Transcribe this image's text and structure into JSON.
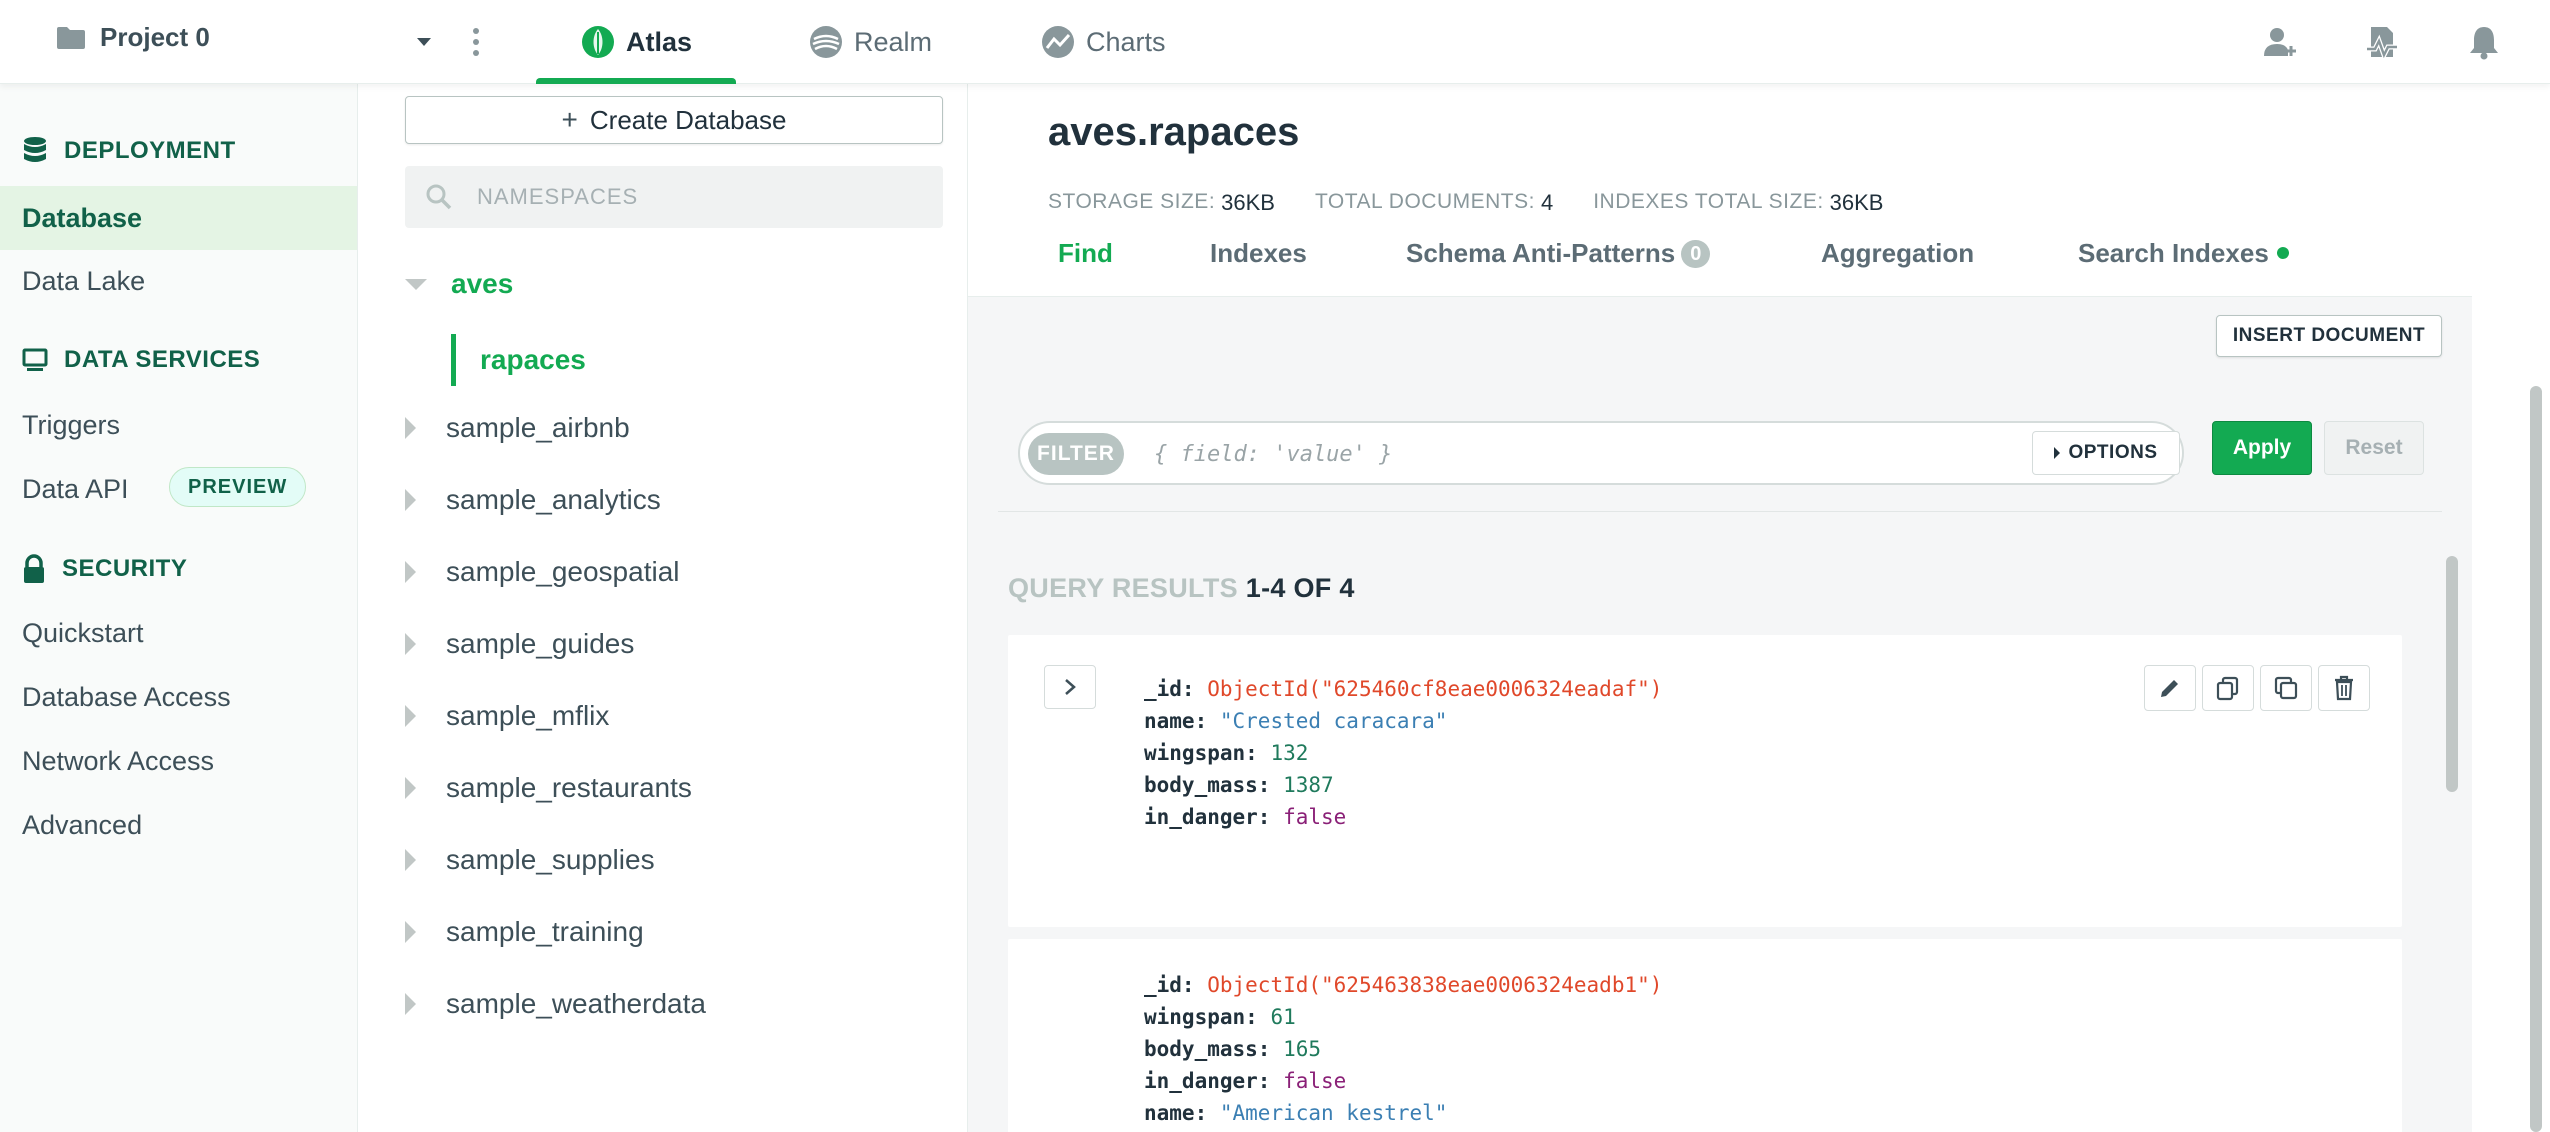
{
  "topbar": {
    "project_name": "Project 0",
    "tabs": [
      {
        "label": "Atlas",
        "active": true
      },
      {
        "label": "Realm",
        "active": false
      },
      {
        "label": "Charts",
        "active": false
      }
    ],
    "accent_color": "#13aa52"
  },
  "leftnav": {
    "deployment": {
      "heading": "DEPLOYMENT",
      "items": [
        "Database",
        "Data Lake"
      ],
      "active": "Database"
    },
    "data_services": {
      "heading": "DATA SERVICES",
      "items": [
        "Triggers",
        "Data API"
      ],
      "preview_badge": "PREVIEW"
    },
    "security": {
      "heading": "SECURITY",
      "items": [
        "Quickstart",
        "Database Access",
        "Network Access",
        "Advanced"
      ]
    }
  },
  "namespaces": {
    "create_button": "Create Database",
    "search_placeholder": "NAMESPACES",
    "expanded_db": "aves",
    "selected_collection": "rapaces",
    "databases": [
      "sample_airbnb",
      "sample_analytics",
      "sample_geospatial",
      "sample_guides",
      "sample_mflix",
      "sample_restaurants",
      "sample_supplies",
      "sample_training",
      "sample_weatherdata"
    ]
  },
  "collection": {
    "title": "aves.rapaces",
    "stats": {
      "storage_label": "STORAGE SIZE:",
      "storage_value": "36KB",
      "docs_label": "TOTAL DOCUMENTS:",
      "docs_value": "4",
      "indexes_label": "INDEXES TOTAL SIZE:",
      "indexes_value": "36KB"
    },
    "tabs": [
      {
        "label": "Find",
        "active": true
      },
      {
        "label": "Indexes"
      },
      {
        "label": "Schema Anti-Patterns",
        "badge": "0"
      },
      {
        "label": "Aggregation"
      },
      {
        "label": "Search Indexes",
        "status_dot": true
      }
    ],
    "insert_button": "INSERT DOCUMENT",
    "filter": {
      "pill": "FILTER",
      "placeholder": "{ field: 'value' }",
      "options_label": "OPTIONS",
      "apply_label": "Apply",
      "reset_label": "Reset"
    },
    "query_results": {
      "label": "QUERY RESULTS",
      "range": "1-4 OF 4"
    },
    "documents": [
      {
        "fields": [
          {
            "key": "_id:",
            "value": "ObjectId(\"625460cf8eae0006324eadaf\")",
            "type": "oid"
          },
          {
            "key": "name:",
            "value": "\"Crested caracara\"",
            "type": "str"
          },
          {
            "key": "wingspan:",
            "value": "132",
            "type": "num"
          },
          {
            "key": "body_mass:",
            "value": "1387",
            "type": "num"
          },
          {
            "key": "in_danger:",
            "value": "false",
            "type": "bool"
          }
        ]
      },
      {
        "fields": [
          {
            "key": "_id:",
            "value": "ObjectId(\"625463838eae0006324eadb1\")",
            "type": "oid"
          },
          {
            "key": "wingspan:",
            "value": "61",
            "type": "num"
          },
          {
            "key": "body_mass:",
            "value": "165",
            "type": "num"
          },
          {
            "key": "in_danger:",
            "value": "false",
            "type": "bool"
          },
          {
            "key": "name:",
            "value": "\"American kestrel\"",
            "type": "str"
          }
        ]
      }
    ]
  }
}
